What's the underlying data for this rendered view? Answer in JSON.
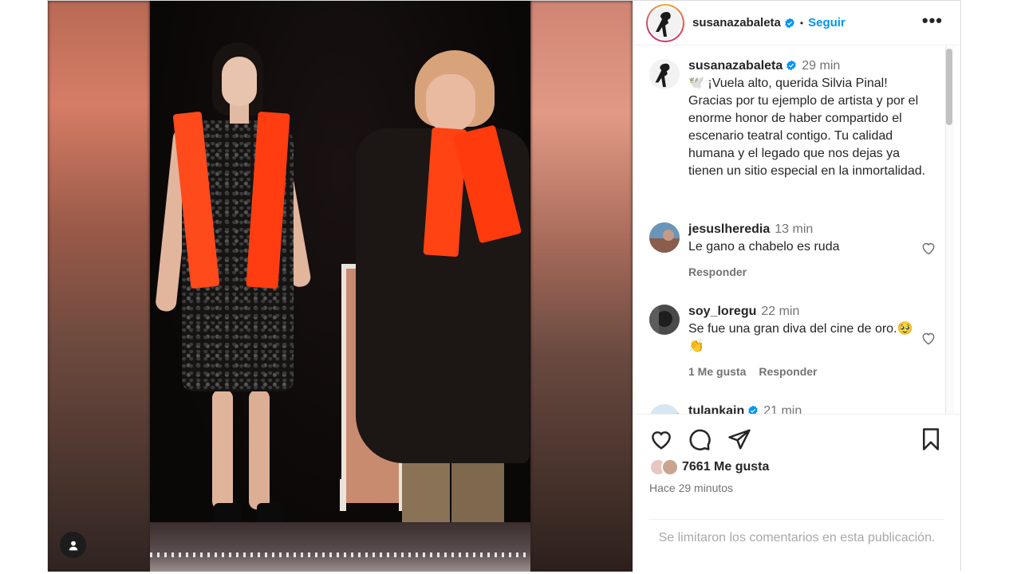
{
  "post": {
    "author": "susanazabaleta",
    "follow_label": "Seguir",
    "separator": "•",
    "more_label": "•••",
    "caption": {
      "username": "susanazabaleta",
      "time": "29 min",
      "text": "🕊️ ¡Vuela alto, querida Silvia Pinal! Gracias por tu ejemplo de artista y por el enorme honor de haber compartido el escenario teatral contigo. Tu calidad humana y el legado que nos dejas ya tienen un sitio especial en la inmortalidad."
    },
    "comments": [
      {
        "username": "jesuslheredia",
        "time": "13 min",
        "text": "Le gano a chabelo es ruda",
        "reply_label": "Responder",
        "likes_label": ""
      },
      {
        "username": "soy_loregu",
        "time": "22 min",
        "text": "Se fue una gran diva del cine de oro.🥹👏",
        "likes_label": "1 Me gusta",
        "reply_label": "Responder"
      },
      {
        "username": "tulankain",
        "time": "21 min",
        "text": ""
      }
    ],
    "likes": "7661 Me gusta",
    "posted_ago": "Hace 29 minutos",
    "comments_limited": "Se limitaron los comentarios en esta publicación."
  },
  "colors": {
    "accent": "#0095f6",
    "verified": "#0095f6",
    "muted": "#737373",
    "text": "#262626",
    "scarf": "#ff4313"
  },
  "icons": {
    "like": "heart-icon",
    "comment": "comment-icon",
    "share": "share-icon",
    "save": "bookmark-icon",
    "tag": "user-tag-icon",
    "verified": "verified-badge-icon"
  }
}
